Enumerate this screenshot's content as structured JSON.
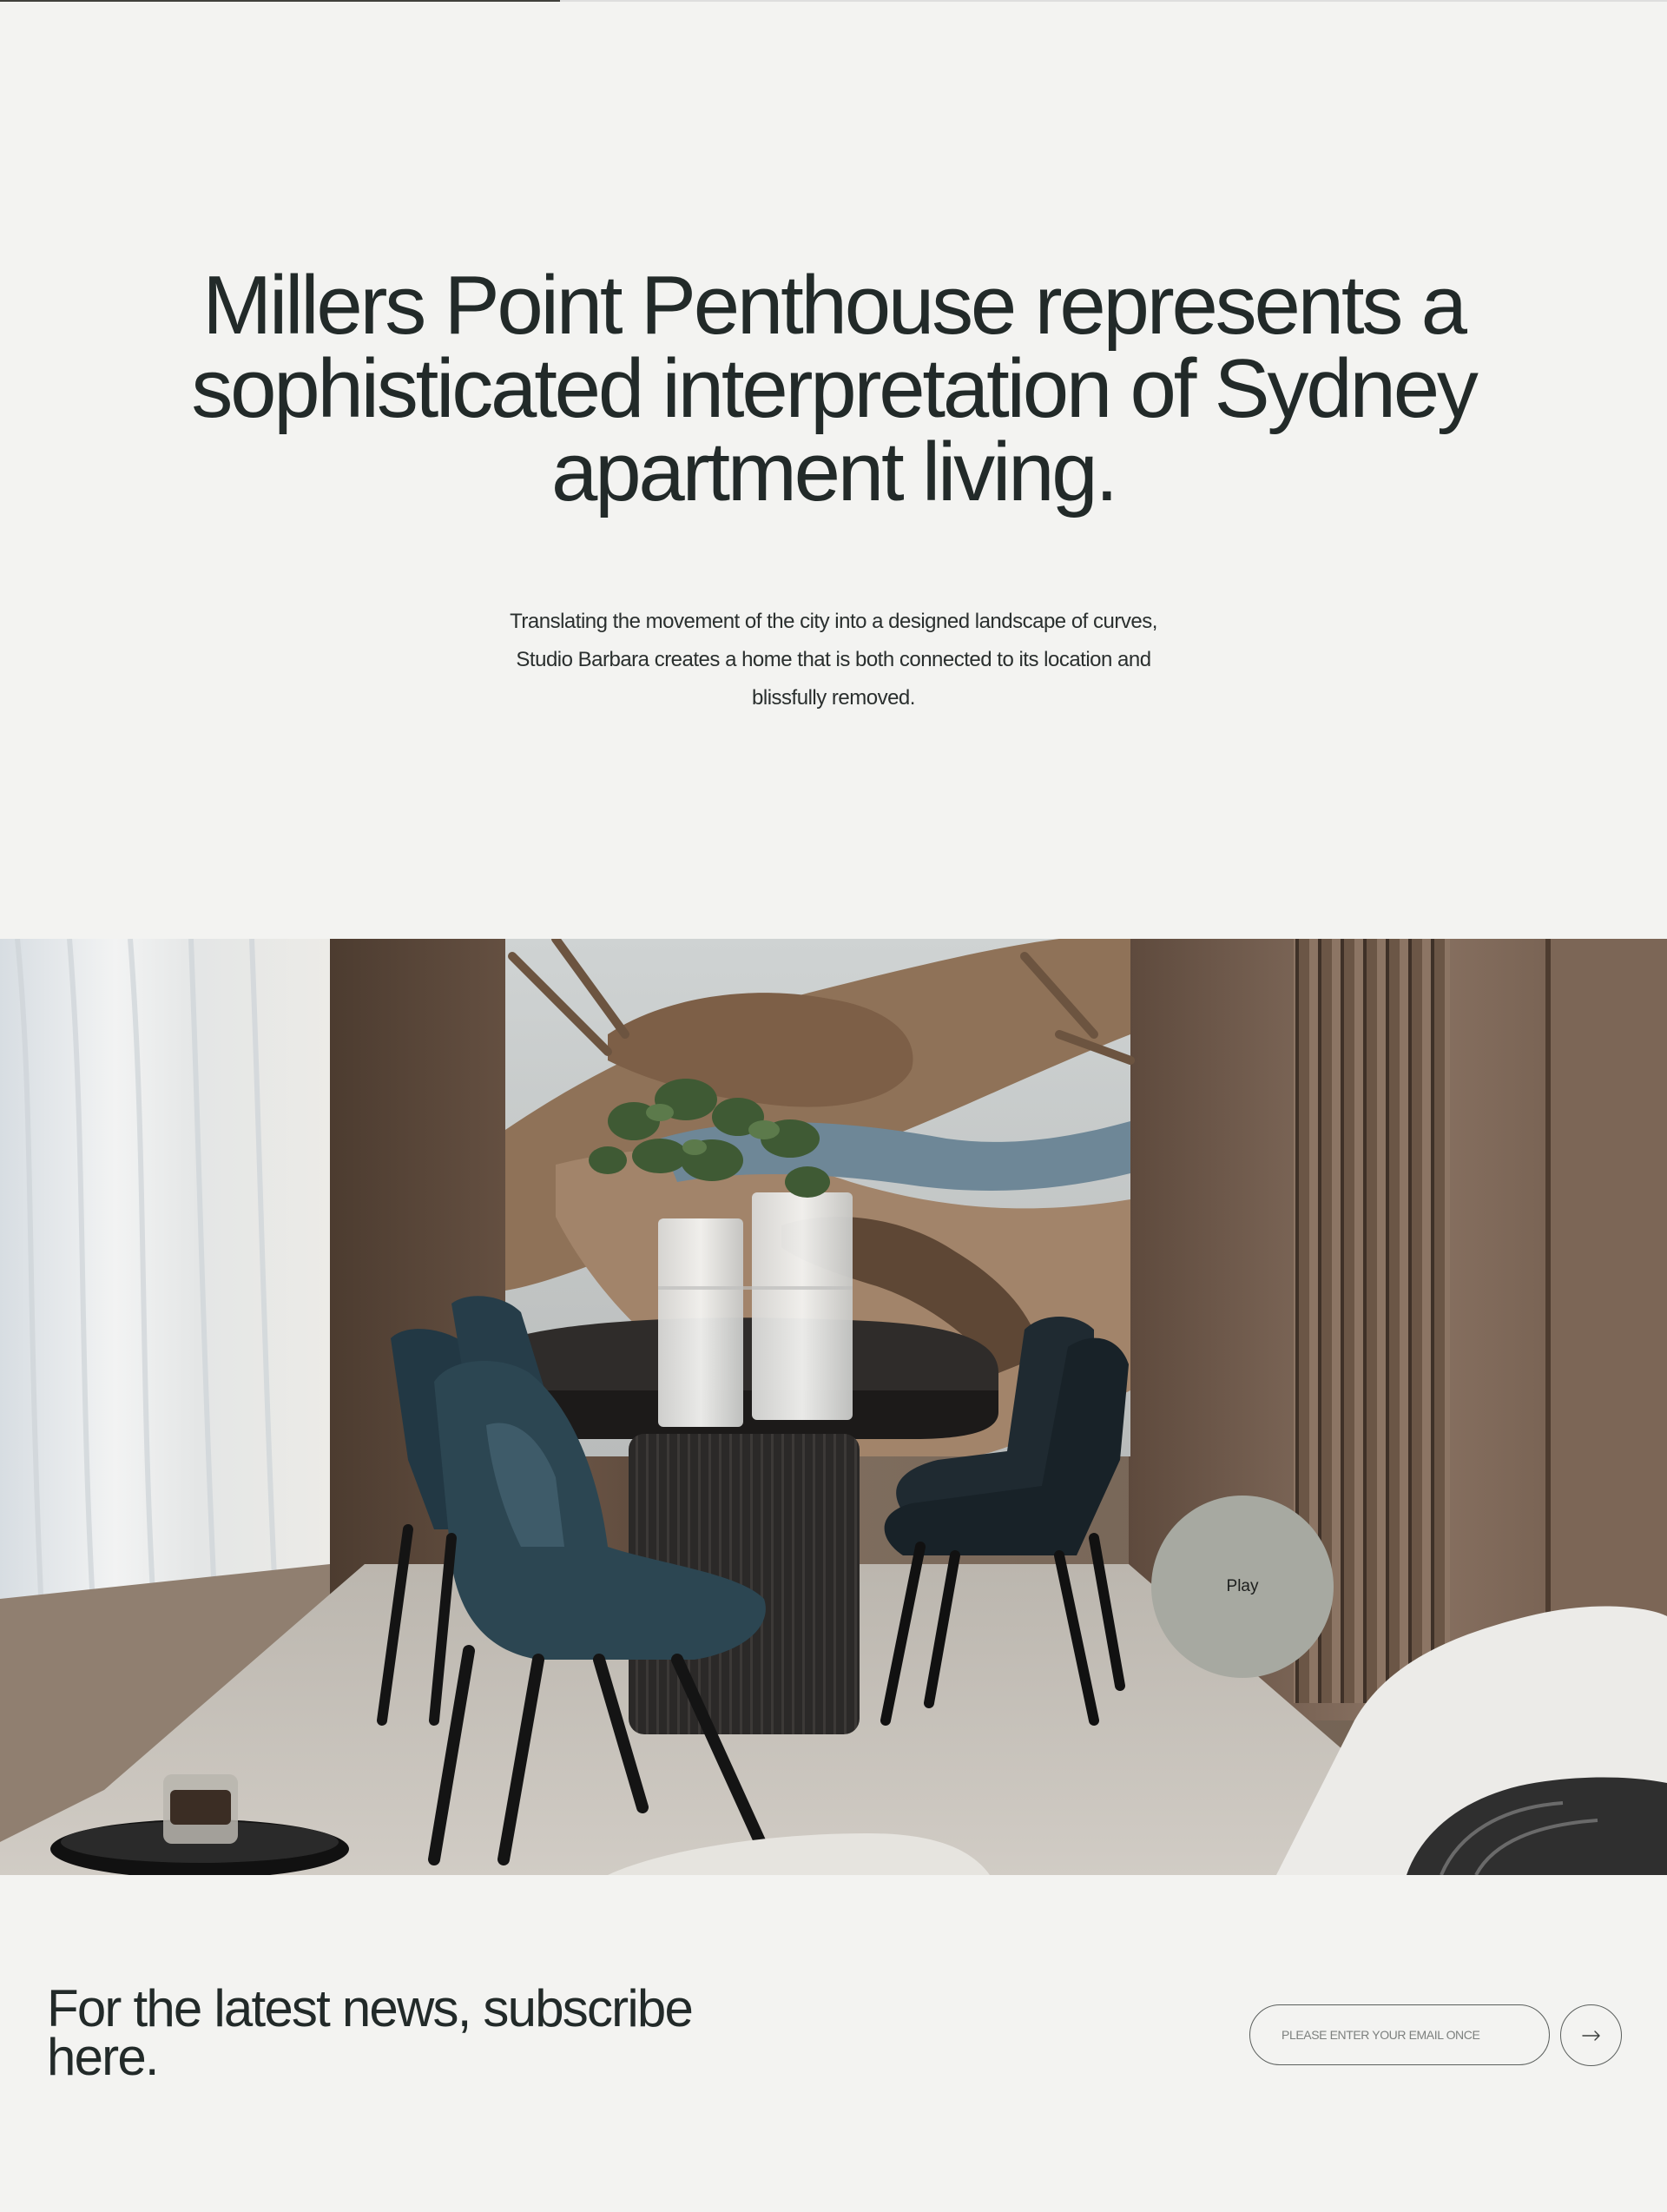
{
  "hero": {
    "headline": "Millers Point Penthouse represents a sophisticated interpretation of Sydney apartment living.",
    "description": "Translating the movement of the city into a designed landscape of curves, Studio Barbara creates a home that is both connected to its location and blissfully removed."
  },
  "media": {
    "play_label": "Play",
    "play_icon": "play-circle"
  },
  "subscribe": {
    "title": "For the latest news, subscribe here.",
    "email_placeholder": "PLEASE ENTER YOUR EMAIL ONCE",
    "submit_icon": "arrow-right-icon"
  },
  "colors": {
    "page_background": "#f3f3f1",
    "text": "#222a29",
    "play_button": "#a7a9a1",
    "outline": "#5b5f5d"
  }
}
